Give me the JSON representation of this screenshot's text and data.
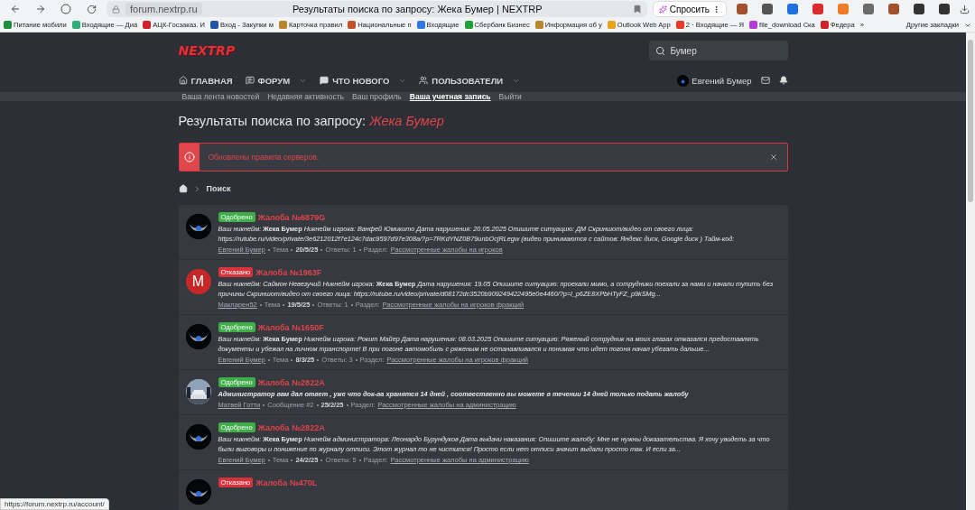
{
  "browser": {
    "address": "forum.nextrp.ru",
    "page_title": "Результаты поиска по запросу: Жека Бумер | NEXTRP",
    "ask_button": "Спросить",
    "extensions": [
      {
        "color": "#a0522d"
      },
      {
        "color": "#555555"
      },
      {
        "color": "#1e6fe0"
      },
      {
        "color": "#d92b2b"
      },
      {
        "color": "#f07a26"
      },
      {
        "color": "#6b6b6b"
      },
      {
        "color": "#a0522d"
      },
      {
        "color": "#333333"
      },
      {
        "color": "#333333"
      }
    ],
    "bookmarks": [
      {
        "label": "Питание мобили",
        "color": "#1e8e3e"
      },
      {
        "label": "Входящие — Диа",
        "color": "#2fae7a"
      },
      {
        "label": "АЦК-Госзаказ. И",
        "color": "#d0202a"
      },
      {
        "label": "Вход - Закупки м",
        "color": "#2456a8"
      },
      {
        "label": "Карточка правил",
        "color": "#b8862b"
      },
      {
        "label": "Национальные п",
        "color": "#c0532a"
      },
      {
        "label": "Входящие",
        "color": "#2f7ae0"
      },
      {
        "label": "Сбербанк Бизнес",
        "color": "#21a038"
      },
      {
        "label": "Информация об у",
        "color": "#b8862b"
      },
      {
        "label": "Outlook Web App",
        "color": "#e8a21b"
      },
      {
        "label": "2 · Входящие — Я",
        "color": "#e53b2b"
      },
      {
        "label": "file_download Ска",
        "color": "#b23bd6"
      },
      {
        "label": "Федера",
        "color": "#d0202a"
      }
    ],
    "more_bookmarks": "»",
    "other_bookmarks": "Другие закладки"
  },
  "header": {
    "logo": "NEXTRP",
    "search_value": "Бумер"
  },
  "nav": [
    {
      "label": "ГЛАВНАЯ",
      "kind": "home",
      "dropdown": false
    },
    {
      "label": "ФОРУМ",
      "kind": "forum",
      "dropdown": true
    },
    {
      "label": "ЧТО НОВОГО",
      "kind": "news",
      "dropdown": true
    },
    {
      "label": "ПОЛЬЗОВАТЕЛИ",
      "kind": "users",
      "dropdown": true
    }
  ],
  "user": {
    "name": "Евгений Бумер"
  },
  "subnav": [
    {
      "label": "Ваша лента новостей",
      "selected": false
    },
    {
      "label": "Недавняя активность",
      "selected": false
    },
    {
      "label": "Ваш профиль",
      "selected": false
    },
    {
      "label": "Ваша учетная запись",
      "selected": true
    },
    {
      "label": "Выйти",
      "selected": false
    }
  ],
  "page_title": {
    "prefix": "Результаты поиска по запросу:",
    "query": "Жека Бумер"
  },
  "notice": {
    "text": "Обновлены правила серверов."
  },
  "breadcrumb": [
    {
      "label": "Поиск"
    }
  ],
  "results": [
    {
      "avatar": {
        "kind": "emblem"
      },
      "status": {
        "label": "Одобрено",
        "color": "#3fae49"
      },
      "title": "Жалоба №6879G",
      "snippet_bold": false,
      "snippet": "Ваш никнейм: **Жека Бумер** Никнейм игрока: Ванфей Юмикито Дата нарушения: 20.05.2025 Опишите ситуацию: ДМ Скриншот/видео от своего лица: https://rutube.ru/video/private/3e6212012f7e124c7dac9597d97e308a/?p=7RKdYNZ0B79unbOcjRLegw (видео принимаются с сайтов: Яндекс диск, Google диск ) Тайм-код:",
      "meta": [
        {
          "parts": [
            {
              "kind": "link",
              "text": "Евгений Бумер"
            }
          ]
        },
        {
          "parts": [
            {
              "kind": "text",
              "text": "Тема"
            }
          ]
        },
        {
          "parts": [
            {
              "kind": "bold",
              "text": "20/5/25"
            }
          ]
        },
        {
          "parts": [
            {
              "kind": "text",
              "text": "Ответы: 1"
            }
          ]
        },
        {
          "parts": [
            {
              "kind": "text",
              "text": "Раздел:"
            },
            {
              "kind": "link",
              "text": "Рассмотренные жалобы на игроков"
            }
          ]
        }
      ]
    },
    {
      "avatar": {
        "kind": "letter",
        "letter": "M"
      },
      "status": {
        "label": "Отказано",
        "color": "#d6333a"
      },
      "title": "Жалоба №1963F",
      "snippet_bold": false,
      "snippet": "Ваш никнейм: Саймон Невезучий Никнейм игрока: **Жека Бумер** Дата нарушения: 19.05 Опишите ситуацию: проехали мимо, а сотрудники поехали за нами и начали тупить без причины Скриншот/видео от своего лица: https://rutube.ru/video/private/d08172dc3520b909249422495e0e4460/?p=l_p6ZE8XPbHTyFZ_p9kSMg...",
      "meta": [
        {
          "parts": [
            {
              "kind": "link",
              "text": "Макларен52"
            }
          ]
        },
        {
          "parts": [
            {
              "kind": "text",
              "text": "Тема"
            }
          ]
        },
        {
          "parts": [
            {
              "kind": "bold",
              "text": "19/5/25"
            }
          ]
        },
        {
          "parts": [
            {
              "kind": "text",
              "text": "Ответы: 1"
            }
          ]
        },
        {
          "parts": [
            {
              "kind": "text",
              "text": "Раздел:"
            },
            {
              "kind": "link",
              "text": "Рассмотренные жалобы на игроков фракций"
            }
          ]
        }
      ]
    },
    {
      "avatar": {
        "kind": "emblem"
      },
      "status": {
        "label": "Одобрено",
        "color": "#3fae49"
      },
      "title": "Жалоба №1650F",
      "snippet_bold": false,
      "snippet": "Ваш никнейм: **Жека Бумер** Никнейм игрока: Рокит Майер Дата нарушения: 08.03.2025 Опишите ситуацию: Ряженый сотрудник на моих глазах отказался предоставлять документы и убежал на личном транспорте! В при погоне автомобиль с ряженым не останавливался и понимая что идет погоня начал убегать дальше...",
      "meta": [
        {
          "parts": [
            {
              "kind": "link",
              "text": "Евгений Бумер"
            }
          ]
        },
        {
          "parts": [
            {
              "kind": "text",
              "text": "Тема"
            }
          ]
        },
        {
          "parts": [
            {
              "kind": "bold",
              "text": "8/3/25"
            }
          ]
        },
        {
          "parts": [
            {
              "kind": "text",
              "text": "Ответы: 3"
            }
          ]
        },
        {
          "parts": [
            {
              "kind": "text",
              "text": "Раздел:"
            },
            {
              "kind": "link",
              "text": "Рассмотренные жалобы на игроков фракций"
            }
          ]
        }
      ]
    },
    {
      "avatar": {
        "kind": "picture"
      },
      "status": {
        "label": "Одобрено",
        "color": "#3fae49"
      },
      "title": "Жалоба №2822A",
      "snippet_bold": true,
      "snippet": "Администратор вам дал ответ , уже что док-ва хранятся 14 дней , соотвественно вы можете в течении 14 дней только подать жалобу",
      "meta": [
        {
          "parts": [
            {
              "kind": "link",
              "text": "Матвей Готти"
            }
          ]
        },
        {
          "parts": [
            {
              "kind": "text",
              "text": "Сообщение #2"
            }
          ]
        },
        {
          "parts": [
            {
              "kind": "bold",
              "text": "25/2/25"
            }
          ]
        },
        {
          "parts": [
            {
              "kind": "text",
              "text": "Раздел:"
            },
            {
              "kind": "link",
              "text": "Рассмотренные жалобы на администрацию"
            }
          ]
        }
      ]
    },
    {
      "avatar": {
        "kind": "emblem"
      },
      "status": {
        "label": "Одобрено",
        "color": "#3fae49"
      },
      "title": "Жалоба №2822A",
      "snippet_bold": false,
      "snippet": "Ваш никнейм: **Жека Бумер** Никнейм администратора: Леонардо Бурундуков Дата выдачи наказания: Опишите жалобу: Мне не нужны доказательства. Я хочу увидеть за что были выговоры и понижение по журналу отписи. Этот журнал то не чистится! Просто если нет отписи значит выдали просто так. И если за...",
      "meta": [
        {
          "parts": [
            {
              "kind": "link",
              "text": "Евгений Бумер"
            }
          ]
        },
        {
          "parts": [
            {
              "kind": "text",
              "text": "Тема"
            }
          ]
        },
        {
          "parts": [
            {
              "kind": "bold",
              "text": "24/2/25"
            }
          ]
        },
        {
          "parts": [
            {
              "kind": "text",
              "text": "Ответы: 5"
            }
          ]
        },
        {
          "parts": [
            {
              "kind": "text",
              "text": "Раздел:"
            },
            {
              "kind": "link",
              "text": "Рассмотренные жалобы на администрацию"
            }
          ]
        }
      ]
    },
    {
      "avatar": {
        "kind": "emblem"
      },
      "status": {
        "label": "Отказано",
        "color": "#d6333a"
      },
      "title": "Жалоба №470L"
    }
  ],
  "status_url": "https://forum.nextrp.ru/account/"
}
